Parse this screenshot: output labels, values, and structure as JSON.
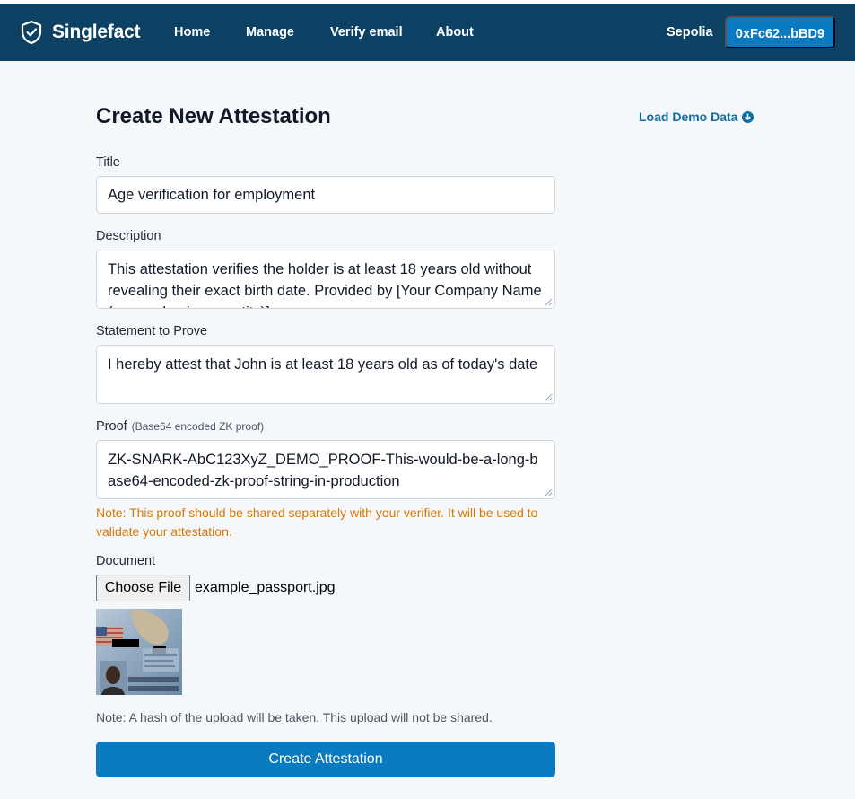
{
  "nav": {
    "brand": "Singlefact",
    "links": [
      "Home",
      "Manage",
      "Verify email",
      "About"
    ],
    "network": "Sepolia",
    "wallet": "0xFc62...bBD9"
  },
  "form": {
    "title": "Create New Attestation",
    "demo_link": "Load Demo Data",
    "title_label": "Title",
    "title_value": "Age verification for employment",
    "description_label": "Description",
    "description_value": "This attestation verifies the holder is at least 18 years old without revealing their exact birth date. Provided by [Your Company Name (or your business entity)]",
    "statement_label": "Statement to Prove",
    "statement_value": "I hereby attest that John is at least 18 years old as of today's date",
    "proof_label": "Proof",
    "proof_hint": "(Base64 encoded ZK proof)",
    "proof_value": "ZK-SNARK-AbC123XyZ_DEMO_PROOF-This-would-be-a-long-base64-encoded-zk-proof-string-in-production",
    "proof_note": "Note: This proof should be shared separately with your verifier. It will be used to validate your attestation.",
    "document_label": "Document",
    "choose_file": "Choose File",
    "file_name": "example_passport.jpg",
    "hash_note": "Note: A hash of the upload will be taken. This upload will not be shared.",
    "submit": "Create Attestation"
  },
  "colors": {
    "navbar": "#0d4163",
    "accent": "#0a7bc1",
    "link": "#0a6ea8",
    "warning": "#d97706"
  },
  "icons": {
    "brand": "shield-check-icon",
    "demo": "arrow-down-circle-icon"
  }
}
